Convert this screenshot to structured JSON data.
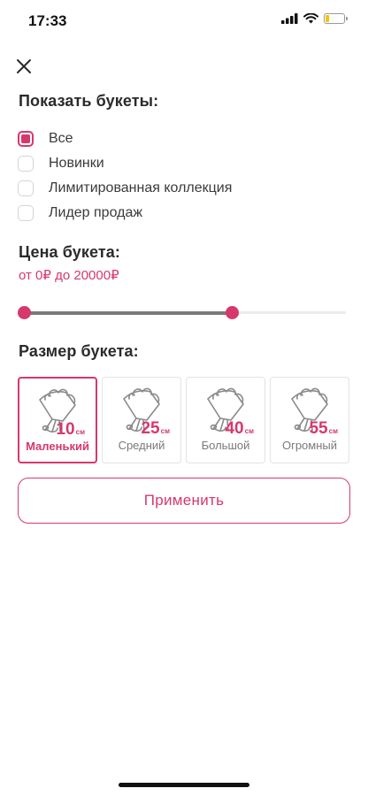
{
  "status_bar": {
    "time": "17:33",
    "battery_level": 0.2,
    "battery_color": "#f5c400"
  },
  "show": {
    "title": "Показать букеты:",
    "options": [
      {
        "label": "Все",
        "checked": true
      },
      {
        "label": "Новинки",
        "checked": false
      },
      {
        "label": "Лимитированная коллекция",
        "checked": false
      },
      {
        "label": "Лидер продаж",
        "checked": false
      }
    ]
  },
  "price": {
    "title": "Цена букета:",
    "range_text": "от 0₽ до 20000₽",
    "min": 0,
    "max": 20000,
    "selected_min_fraction": 0.0,
    "selected_max_fraction": 0.65
  },
  "size": {
    "title": "Размер букета:",
    "unit": "см",
    "cards": [
      {
        "value": "10",
        "label": "Маленький",
        "selected": true
      },
      {
        "value": "25",
        "label": "Средний",
        "selected": false
      },
      {
        "value": "40",
        "label": "Большой",
        "selected": false
      },
      {
        "value": "55",
        "label": "Огромный",
        "selected": false
      }
    ]
  },
  "apply_label": "Применить",
  "colors": {
    "accent": "#d6386d",
    "muted_text": "#7a7a7a",
    "heading": "#2b2b2b"
  },
  "icons": {
    "close": "close-icon",
    "bouquet": "bouquet-icon"
  }
}
